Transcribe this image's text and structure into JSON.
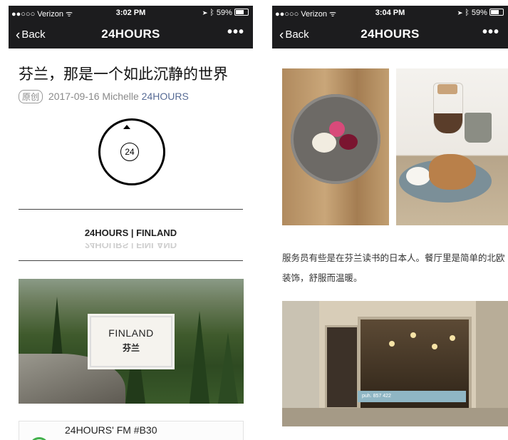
{
  "screens": [
    {
      "status": {
        "carrier": "●●○○○ Verizon ᯤ",
        "time": "3:02 PM",
        "battery": "59%"
      },
      "nav": {
        "back": "Back",
        "title": "24HOURS",
        "more": "•••"
      },
      "article": {
        "title": "芬兰，那是一个如此沉静的世界",
        "tag": "原创",
        "date": "2017-09-16",
        "author": "Michelle",
        "account": "24HOURS",
        "logo_text": "24",
        "brand_line": "24HOURS | FINLAND",
        "hero_en": "FINLAND",
        "hero_zh": "芬兰",
        "fm_label": "24HOURS' FM #B30"
      }
    },
    {
      "status": {
        "carrier": "●●○○○ Verizon ᯤ",
        "time": "3:04 PM",
        "battery": "59%"
      },
      "nav": {
        "back": "Back",
        "title": "24HOURS",
        "more": "•••"
      },
      "article": {
        "paragraph": "服务员有些是在芬兰读书的日本人。餐厅里是简单的北欧装饰，舒服而温暖。",
        "cafe_sign": "puh. 857 422"
      }
    }
  ],
  "colors": {
    "bar": "#1c1c1e",
    "link": "#576b95",
    "fm_ring": "#40b04a"
  }
}
